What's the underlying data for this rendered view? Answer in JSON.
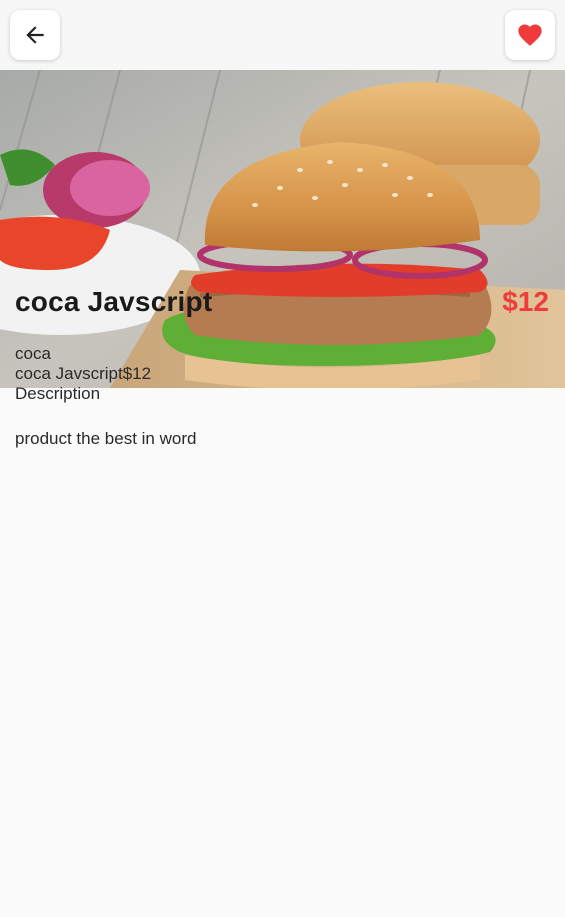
{
  "header": {
    "back_icon": "arrow-left-icon",
    "favorite_icon": "heart-icon",
    "favorite_color": "#ef3b3b"
  },
  "product": {
    "image_icon": "burger-image",
    "title": "coca Javscript",
    "price": "$12",
    "category": "coca",
    "name_price_line": "coca Javscript$12",
    "description_label": "Description",
    "description_text": "product the best in word"
  }
}
